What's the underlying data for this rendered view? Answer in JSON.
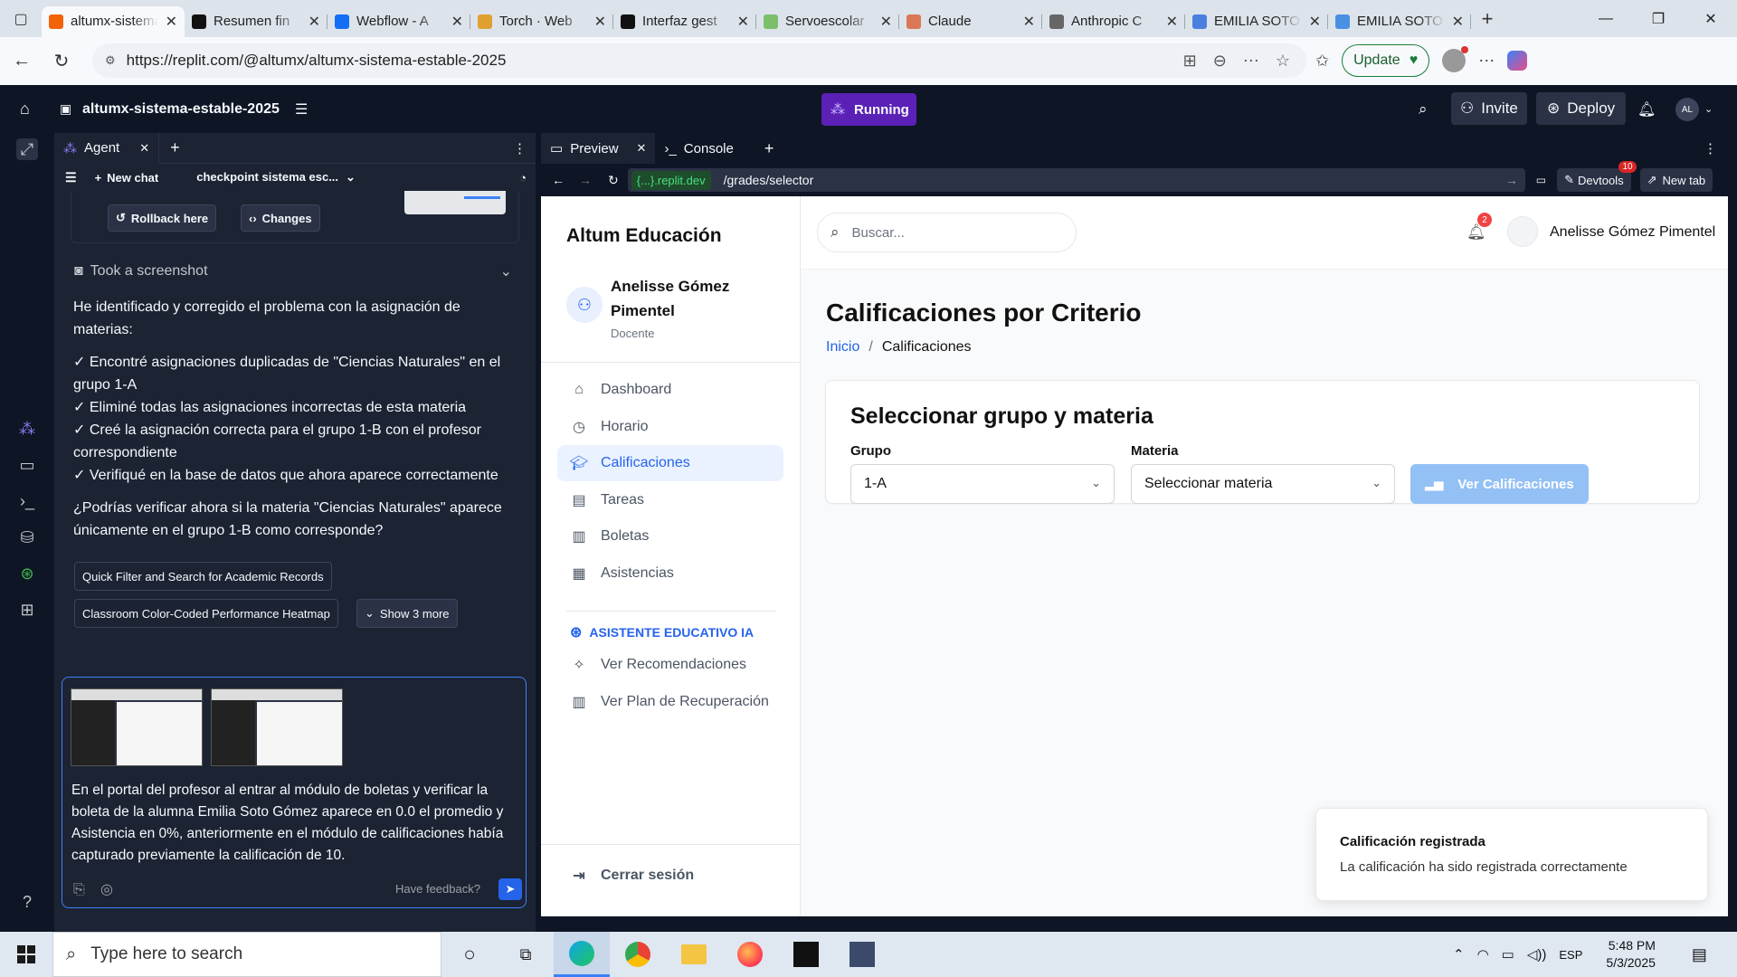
{
  "browser": {
    "tabs": [
      {
        "title": "altumx-sistema",
        "active": true,
        "color": "#f26207"
      },
      {
        "title": "Resumen fin",
        "color": "#111111"
      },
      {
        "title": "Webflow - A",
        "color": "#146ef5"
      },
      {
        "title": "Torch · Web",
        "color": "#e0a030"
      },
      {
        "title": "Interfaz gest",
        "color": "#111111"
      },
      {
        "title": "Servoescolar",
        "color": "#7bbf6a"
      },
      {
        "title": "Claude",
        "color": "#d97757"
      },
      {
        "title": "Anthropic C",
        "color": "#666666"
      },
      {
        "title": "EMILIA SOTO",
        "color": "#4a7fe0"
      },
      {
        "title": "EMILIA SOTO",
        "color": "#4a90e2"
      }
    ],
    "url": "https://replit.com/@altumx/altumx-sistema-estable-2025",
    "update_label": "Update"
  },
  "replit": {
    "project_name": "altumx-sistema-estable-2025",
    "run_status": "Running",
    "invite_label": "Invite",
    "deploy_label": "Deploy",
    "user_initials": "AL",
    "accent": "#6d28d9"
  },
  "agent": {
    "tab_label": "Agent",
    "new_chat_label": "New chat",
    "checkpoint_label": "checkpoint sistema esc...",
    "rollback_label": "Rollback here",
    "changes_label": "Changes",
    "screenshot_label": "Took a screenshot",
    "message_intro": "He identificado y corregido el problema con la asignación de materias:",
    "checklist": [
      "✓ Encontré asignaciones duplicadas de \"Ciencias Naturales\" en el grupo 1-A",
      "✓ Eliminé todas las asignaciones incorrectas de esta materia",
      "✓ Creé la asignación correcta para el grupo 1-B con el profesor correspondiente",
      "✓ Verifiqué en la base de datos que ahora aparece correctamente"
    ],
    "question": "¿Podrías verificar ahora si la materia \"Ciencias Naturales\" aparece únicamente en el grupo 1-B como corresponde?",
    "suggestions": [
      "Quick Filter and Search for Academic Records",
      "Classroom Color-Coded Performance Heatmap"
    ],
    "show_more_label": "Show 3 more",
    "composer_text": "En el portal del profesor al entrar al módulo de boletas y verificar la boleta de la alumna Emilia Soto Gómez aparece en 0.0 el promedio y Asistencia en 0%, anteriormente en el módulo de calificaciones había capturado previamente la calificación de 10.",
    "feedback_label": "Have feedback?"
  },
  "preview": {
    "tab_preview": "Preview",
    "tab_console": "Console",
    "domain": "{...}.replit.dev",
    "path": "/grades/selector",
    "devtools_label": "Devtools",
    "devtools_badge": "10",
    "new_tab_label": "New tab"
  },
  "site": {
    "brand": "Altum Educación",
    "user_name": "Anelisse Gómez Pimentel",
    "user_role": "Docente",
    "nav": [
      {
        "label": "Dashboard",
        "icon": "home-icon"
      },
      {
        "label": "Horario",
        "icon": "clock-icon"
      },
      {
        "label": "Calificaciones",
        "icon": "graduation-cap-icon",
        "active": true
      },
      {
        "label": "Tareas",
        "icon": "clipboard-icon"
      },
      {
        "label": "Boletas",
        "icon": "document-icon"
      },
      {
        "label": "Asistencias",
        "icon": "calendar-icon"
      }
    ],
    "ai_section": "ASISTENTE EDUCATIVO IA",
    "ai_nav": [
      {
        "label": "Ver Recomendaciones",
        "icon": "lightbulb-icon"
      },
      {
        "label": "Ver Plan de Recuperación",
        "icon": "document-icon"
      }
    ],
    "logout_label": "Cerrar sesión",
    "search_placeholder": "Buscar...",
    "notification_count": "2",
    "page_title": "Calificaciones por Criterio",
    "breadcrumb_home": "Inicio",
    "breadcrumb_sep": "/",
    "breadcrumb_current": "Calificaciones",
    "card_title": "Seleccionar grupo y materia",
    "group_label": "Grupo",
    "group_value": "1-A",
    "subject_label": "Materia",
    "subject_value": "Seleccionar materia",
    "view_button": "Ver Calificaciones",
    "toast_title": "Calificación registrada",
    "toast_body": "La calificación ha sido registrada correctamente"
  },
  "taskbar": {
    "search_placeholder": "Type here to search",
    "language": "ESP",
    "time": "5:48 PM",
    "date": "5/3/2025"
  }
}
